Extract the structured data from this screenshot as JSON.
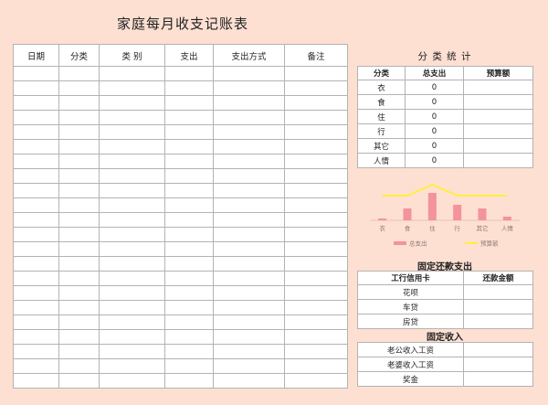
{
  "title": "家庭每月收支记账表",
  "ledger": {
    "headers": [
      "日期",
      "分类",
      "类 别",
      "支出",
      "支出方式",
      "备注"
    ],
    "row_count": 22
  },
  "stats": {
    "title": "分 类 统 计",
    "headers": [
      "分类",
      "总支出",
      "预算额"
    ],
    "rows": [
      {
        "cat": "衣",
        "total": "0",
        "budget": ""
      },
      {
        "cat": "食",
        "total": "0",
        "budget": ""
      },
      {
        "cat": "住",
        "total": "0",
        "budget": ""
      },
      {
        "cat": "行",
        "total": "0",
        "budget": ""
      },
      {
        "cat": "其它",
        "total": "0",
        "budget": ""
      },
      {
        "cat": "人情",
        "total": "0",
        "budget": ""
      }
    ]
  },
  "chart_data": {
    "type": "bar",
    "categories": [
      "衣",
      "食",
      "住",
      "行",
      "其它",
      "人情"
    ],
    "series": [
      {
        "name": "总支出",
        "kind": "bar",
        "color": "#f4939a",
        "values": [
          1,
          6.5,
          15,
          8.5,
          6.5,
          2
        ]
      },
      {
        "name": "预算额",
        "kind": "line",
        "color": "#ffef3a",
        "values": [
          13.5,
          13.5,
          19.5,
          13.5,
          13.5,
          13.5
        ]
      }
    ],
    "ylim": [
      0,
      22
    ],
    "grid": false,
    "legend": "bottom"
  },
  "repay": {
    "title": "固定还款支出",
    "headers": [
      "工行信用卡",
      "还款金额"
    ],
    "rows": [
      {
        "name": "花呗",
        "amount": ""
      },
      {
        "name": "车贷",
        "amount": ""
      },
      {
        "name": "房贷",
        "amount": ""
      }
    ]
  },
  "income": {
    "title": "固定收入",
    "rows": [
      {
        "name": "老公收入工资",
        "amount": ""
      },
      {
        "name": "老婆收入工资",
        "amount": ""
      },
      {
        "name": "奖金",
        "amount": ""
      }
    ]
  }
}
